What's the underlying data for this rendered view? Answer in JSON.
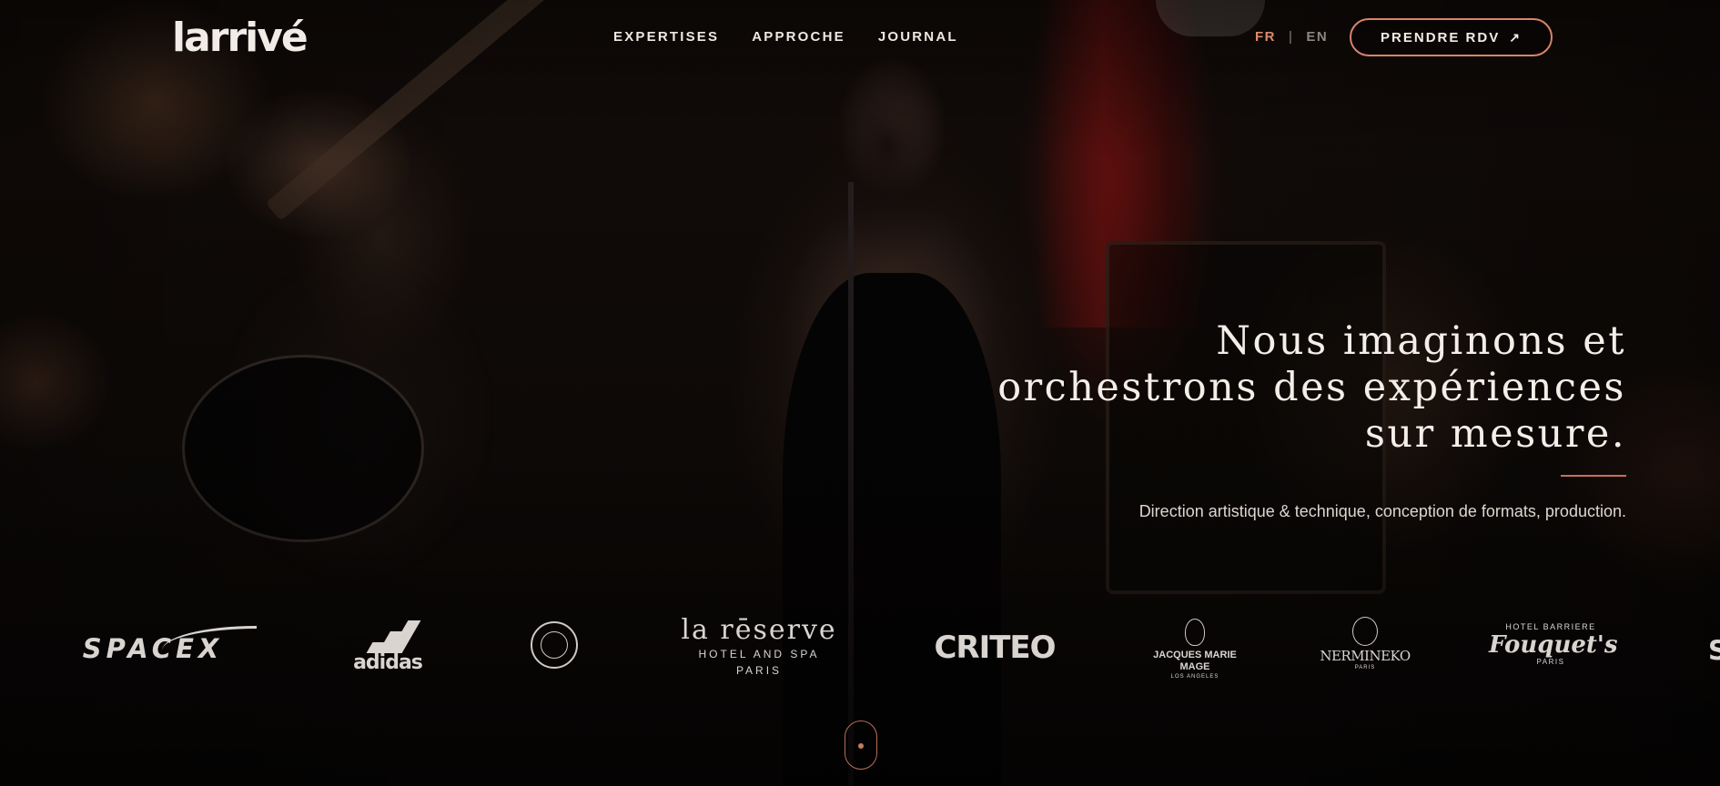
{
  "header": {
    "logo_text": "larrivé",
    "nav": [
      {
        "label": "EXPERTISES"
      },
      {
        "label": "APPROCHE"
      },
      {
        "label": "JOURNAL"
      }
    ],
    "language": {
      "active": "FR",
      "separator": "|",
      "inactive": "EN"
    },
    "cta_label": "PRENDRE RDV",
    "cta_icon": "arrow-up-right-icon"
  },
  "hero": {
    "headline_line1": "Nous imaginons et",
    "headline_line2": "orchestrons des expériences",
    "headline_line3": "sur mesure.",
    "subline": "Direction artistique & technique, conception de formats, production."
  },
  "clients": {
    "spacex": "SPACEX",
    "adidas": "adidas",
    "lareserve_main": "la rēserve",
    "lareserve_sub1": "HOTEL AND SPA",
    "lareserve_sub2": "PARIS",
    "criteo": "CRITEO",
    "jmm_name": "JACQUES MARIE MAGE",
    "jmm_place": "LOS ANGELES",
    "nermineko_name": "NERMINEKO",
    "nermineko_place": "PARIS",
    "fouquets_top": "HOTEL BARRIERE",
    "fouquets_name": "Fouquet's",
    "fouquets_place": "PARIS",
    "edge_logo": "S"
  },
  "colors": {
    "accent": "#d8846a",
    "text": "#f4eee8",
    "muted": "#8d8580"
  },
  "icons": {
    "scroll_indicator": "mouse-scroll-icon"
  }
}
